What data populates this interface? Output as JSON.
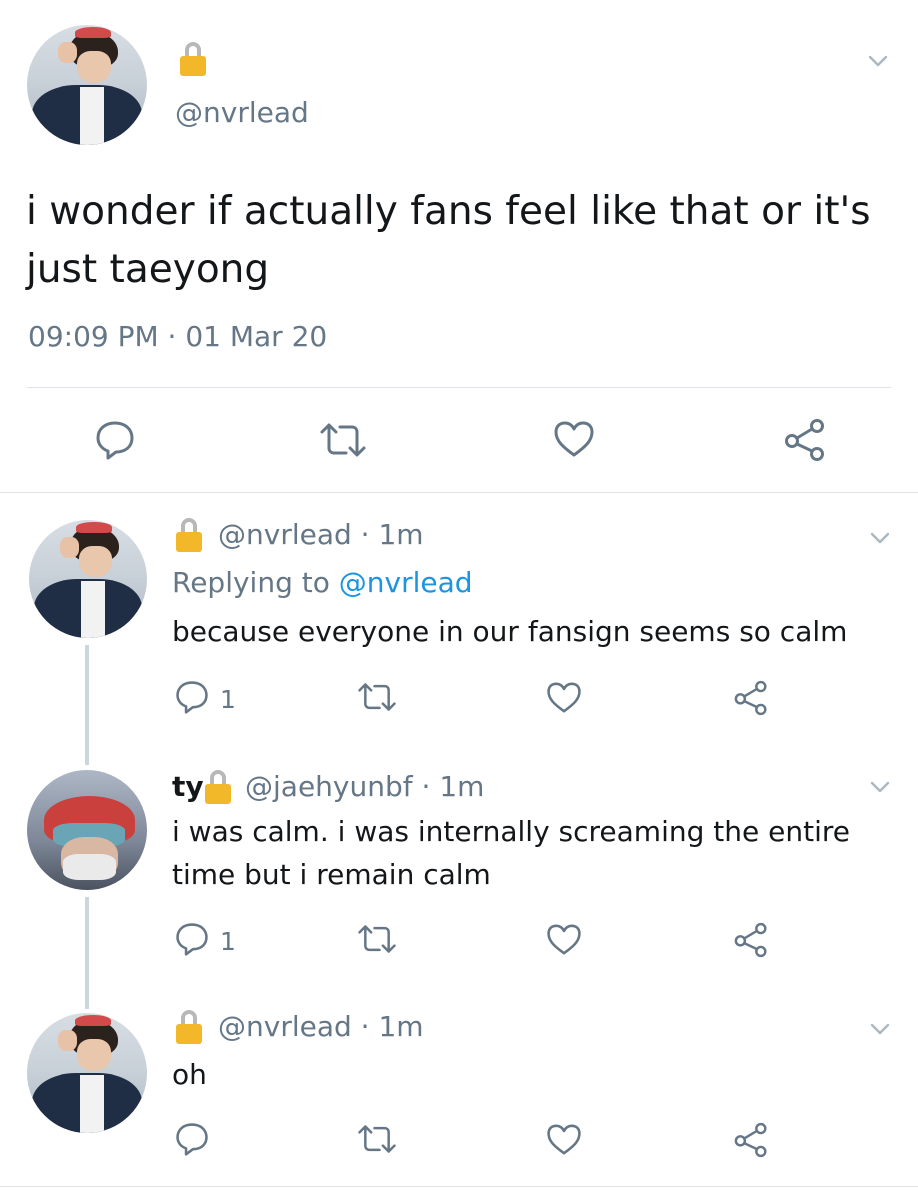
{
  "main_tweet": {
    "handle": "@nvrlead",
    "text": "i wonder if actually fans feel like that or it's just taeyong",
    "timestamp": "09:09 PM · 01 Mar 20"
  },
  "replies": [
    {
      "handle": "@nvrlead",
      "time": "1m",
      "replying_label": "Replying to ",
      "replying_to": "@nvrlead",
      "text": "because everyone in our fansign seems so calm",
      "reply_count": "1"
    },
    {
      "display_name": "ty",
      "handle": "@jaehyunbf",
      "time": "1m",
      "text": "i was calm. i was internally screaming the entire time but i remain calm",
      "reply_count": "1"
    },
    {
      "handle": "@nvrlead",
      "time": "1m",
      "text": "oh"
    }
  ],
  "icons": {
    "lock": "lock-icon",
    "reply": "reply-icon",
    "retweet": "retweet-icon",
    "like": "heart-icon",
    "share": "share-icon",
    "more": "chevron-down-icon"
  },
  "colors": {
    "text": "#14171a",
    "secondary": "#657786",
    "link": "#1b95e0",
    "divider": "#dfe3e8",
    "thread_line": "#ccd6dd",
    "lock": "#f3b82a"
  }
}
